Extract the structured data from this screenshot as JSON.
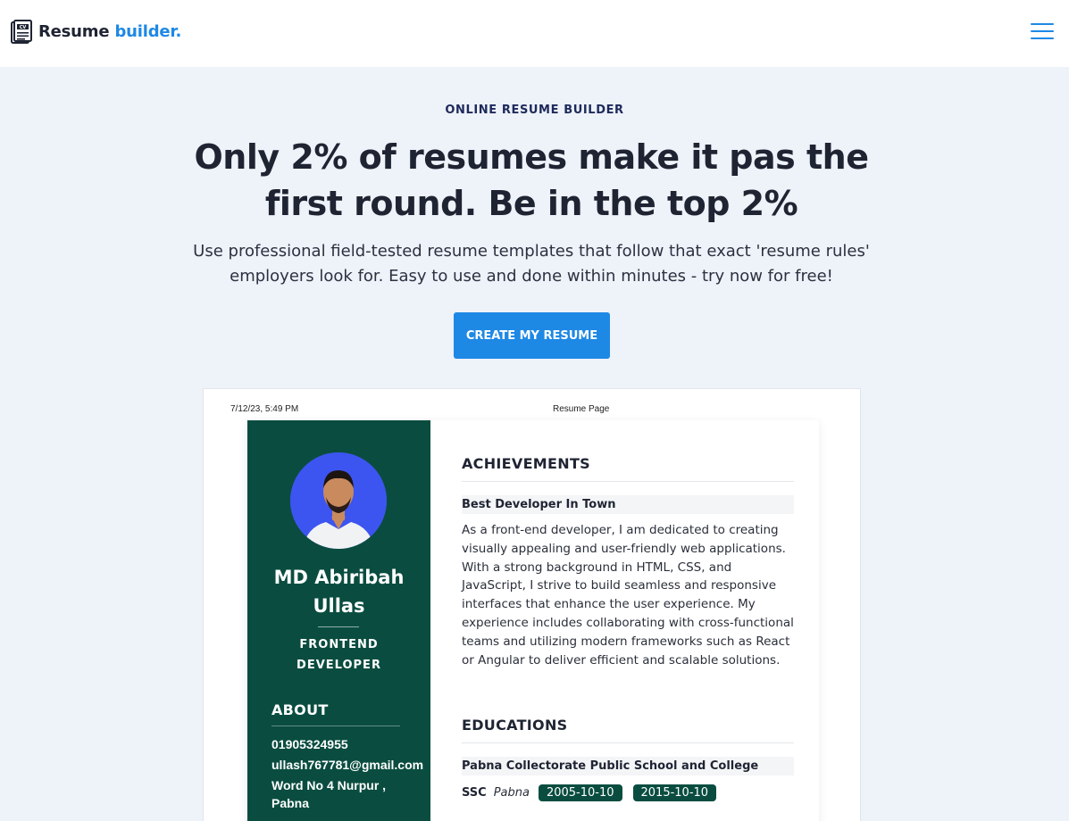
{
  "header": {
    "brand_main": "Resume",
    "brand_accent": "builder.",
    "brand_icon": "cv-document-icon",
    "menu_icon": "hamburger-menu-icon",
    "accent_color": "#1e88e5"
  },
  "hero": {
    "eyebrow": "ONLINE RESUME BUILDER",
    "headline": "Only 2% of resumes make it pas the first round. Be in the top 2%",
    "subline": "Use professional field-tested resume templates that follow that exact 'resume rules' employers look for. Easy to use and done within minutes - try now for free!",
    "cta_label": "CREATE MY RESUME"
  },
  "preview": {
    "print_date": "7/12/23, 5:49 PM",
    "print_title": "Resume Page",
    "sidebar_color": "#0a4d40",
    "profile": {
      "name": "MD Abiribah Ullas",
      "role": "FRONTEND DEVELOPER",
      "about_heading": "ABOUT",
      "phone": "01905324955",
      "email": "ullash767781@gmail.com",
      "address": "Word No 4 Nurpur , Pabna"
    },
    "achievements": {
      "heading": "ACHIEVEMENTS",
      "item_title": "Best Developer In Town",
      "item_text": "As a front-end developer, I am dedicated to creating visually appealing and user-friendly web applications. With a strong background in HTML, CSS, and JavaScript, I strive to build seamless and responsive interfaces that enhance the user experience. My experience includes collaborating with cross-functional teams and utilizing modern frameworks such as React or Angular to deliver efficient and scalable solutions."
    },
    "educations": {
      "heading": "EDUCATIONS",
      "item_title": "Pabna Collectorate Public School and College",
      "degree": "SSC",
      "place": "Pabna",
      "start": "2005-10-10",
      "end": "2015-10-10"
    }
  }
}
